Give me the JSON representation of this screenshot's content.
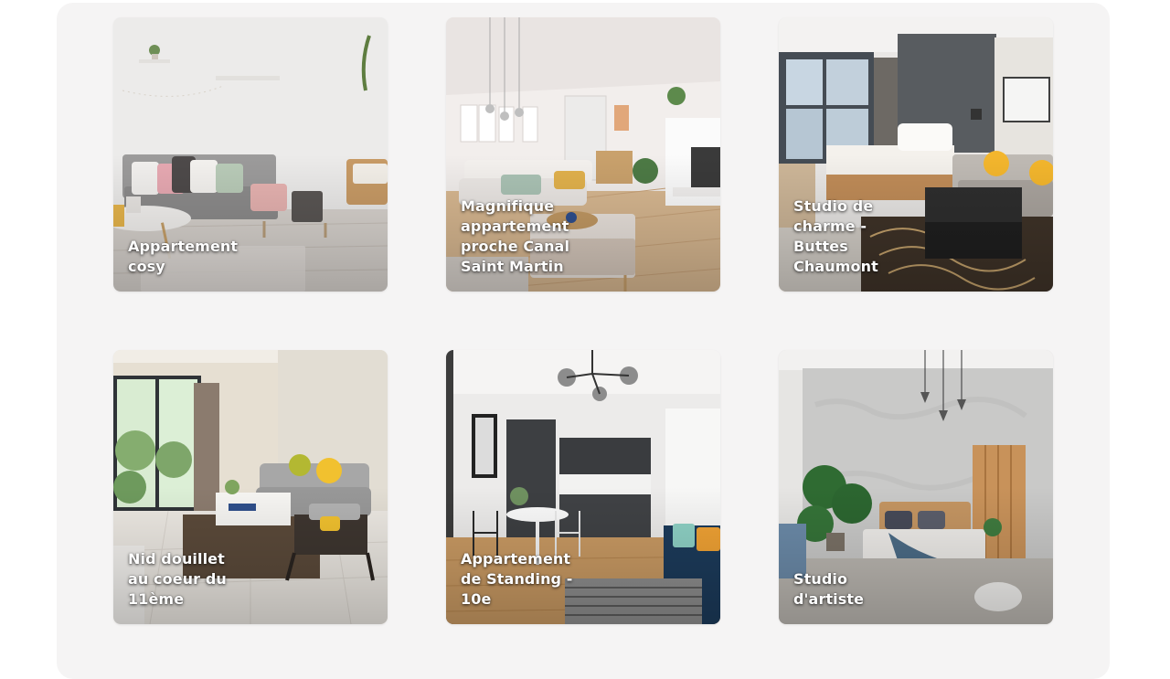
{
  "listings": [
    {
      "title": "Appartement cosy",
      "image_icon": "living-room-photo"
    },
    {
      "title": "Magnifique appartement proche Canal Saint Martin",
      "image_icon": "open-plan-apartment-photo"
    },
    {
      "title": "Studio de charme - Buttes Chaumont",
      "image_icon": "studio-bedroom-photo"
    },
    {
      "title": "Nid douillet au coeur du 11ème",
      "image_icon": "bright-living-room-photo"
    },
    {
      "title": "Appartement de Standing - 10e",
      "image_icon": "kitchen-dining-photo"
    },
    {
      "title": "Studio d'artiste",
      "image_icon": "loft-bedroom-photo"
    }
  ],
  "colors": {
    "panel_background": "#f5f4f4",
    "title_text": "#ffffff"
  }
}
